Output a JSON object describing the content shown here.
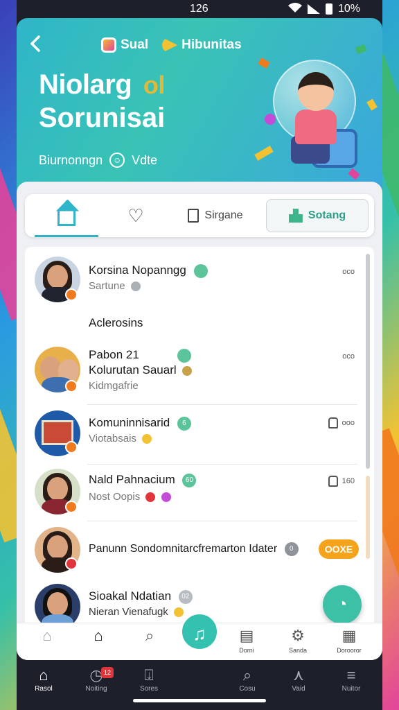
{
  "status": {
    "time": "126",
    "battery": "10%"
  },
  "header": {
    "brand_1": "Sual",
    "brand_2": "Hibunitas",
    "title_line_1": "Niolarg",
    "title_tag": "ol",
    "title_line_2": "Sorunisai",
    "subtitle": "Biurnonngn",
    "subtitle_tail": "Vdte"
  },
  "tabs": {
    "save_label": "Sirgane",
    "active_label": "Sotang"
  },
  "contacts": [
    {
      "name": "Korsina Nopanngg",
      "chip": "",
      "sub": "Sartune",
      "meta": "oco"
    },
    {
      "section": "Aclerosins"
    },
    {
      "name": "Pabon 21",
      "name_2": "Kolurutan Sauarl",
      "chip": "",
      "sub": "Kidmgafrie",
      "meta": "oco"
    },
    {
      "name": "Komuninnisarid",
      "chip": "6",
      "sub": "Viotabsais",
      "meta": "ooo"
    },
    {
      "name": "Nald Pahnacium",
      "chip": "60",
      "sub": "Nost Oopis",
      "meta": "160"
    },
    {
      "name": "Panunn Sondomnitarcfremarton Idater",
      "chip": "0",
      "tag": "OOXE"
    },
    {
      "name": "Sioakal Ndatian",
      "chip": "02",
      "sub": "Nieran Vienafugk"
    }
  ],
  "bottom_strip": {
    "item_4": "Dorni",
    "item_5": "Sanda",
    "item_6": "Dorooror"
  },
  "navbar": {
    "items": [
      "Rasol",
      "Noiting",
      "Sores",
      "",
      "Cosu",
      "Vaid",
      "Nuitor"
    ],
    "badge": "12"
  },
  "colors": {
    "accent": "#2fb5c9",
    "primary_green": "#3cc0a6",
    "tag_orange": "#f5a31a"
  }
}
